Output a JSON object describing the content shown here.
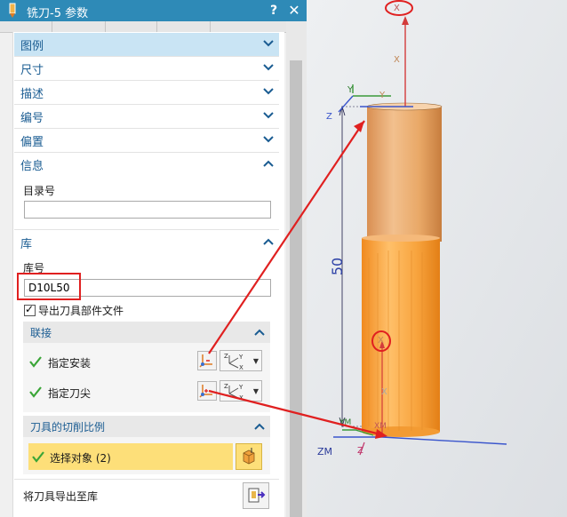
{
  "window": {
    "title": "铣刀-5 参数",
    "help": "?",
    "close": "✕"
  },
  "sections": {
    "legend": "图例",
    "dimensions": "尺寸",
    "description": "描述",
    "numbering": "编号",
    "offset": "偏置",
    "info": "信息",
    "library": "库"
  },
  "info": {
    "catalog_label": "目录号",
    "catalog_value": ""
  },
  "library": {
    "lib_label": "库号",
    "lib_value": "D10L50",
    "export_checkbox_label": "导出刀具部件文件",
    "export_checked": true
  },
  "associations": {
    "title": "联接",
    "specify_mount": "指定安装",
    "specify_tip": "指定刀尖"
  },
  "cut_ratio": {
    "title": "刀具的切削比例",
    "select_object": "选择对象 (2)"
  },
  "export_to_library": "将刀具导出至库",
  "viewport": {
    "dimension_text": "50",
    "axis_labels": {
      "x_top": "X",
      "x_mid": "X",
      "y_top": "Y",
      "y_top2": "Y",
      "z_top": "Z",
      "x_lower": "X",
      "x_lower2": "X",
      "zm": "ZM",
      "xm": "XM",
      "ym": "YM",
      "z_bottom": "Z"
    }
  },
  "colors": {
    "titlebar": "#2e8ab7",
    "accent_text": "#1a5c92",
    "active_section": "#c9e4f4",
    "selection": "#fddf79",
    "tool_body": "#f6a84a",
    "annotation_red": "#e02020"
  }
}
